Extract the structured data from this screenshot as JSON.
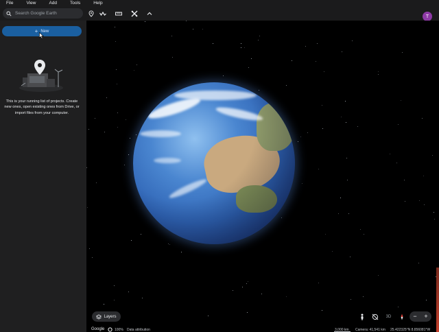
{
  "menubar": {
    "items": [
      "File",
      "View",
      "Add",
      "Tools",
      "Help"
    ]
  },
  "toolbar": {
    "search_placeholder": "Search Google Earth",
    "tools": [
      "pin-icon",
      "path-icon",
      "ruler-icon",
      "projects-icon",
      "chevron-up-icon"
    ],
    "avatar_letter": "T",
    "avatar_color": "#8e3aa6"
  },
  "sidebar": {
    "new_label": "New",
    "empty_message": "This is your running list of projects. Create new ones, open existing ones from Drive, or import files from your computer.",
    "accent_color": "#1a5fa0"
  },
  "map": {
    "layers_label": "Layers",
    "view_mode_label": "3D",
    "zoom_in": "+",
    "zoom_out": "−"
  },
  "status": {
    "logo": "Google",
    "load_percent": "100%",
    "attribution": "Data attribution",
    "scale": "3,000 km",
    "camera": "Camera: 41,541 km",
    "coordinates": "25.422325°N 8.856081°W"
  }
}
